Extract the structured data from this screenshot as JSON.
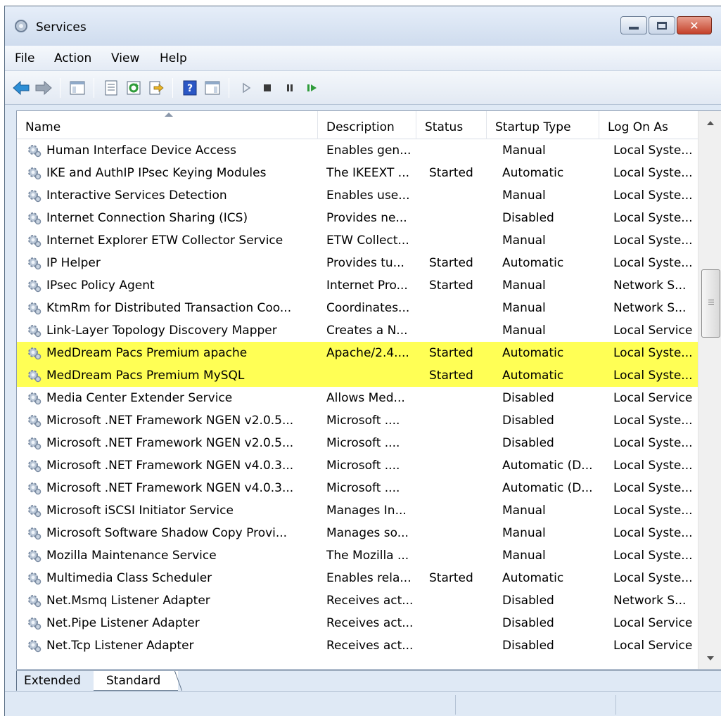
{
  "window": {
    "title": "Services"
  },
  "menu": [
    "File",
    "Action",
    "View",
    "Help"
  ],
  "columns": [
    "Name",
    "Description",
    "Status",
    "Startup Type",
    "Log On As"
  ],
  "rows": [
    {
      "name": "Human Interface Device Access",
      "description": "Enables gen...",
      "status": "",
      "startup": "Manual",
      "logon": "Local Syste...",
      "highlighted": false
    },
    {
      "name": "IKE and AuthIP IPsec Keying Modules",
      "description": "The IKEEXT ...",
      "status": "Started",
      "startup": "Automatic",
      "logon": "Local Syste...",
      "highlighted": false
    },
    {
      "name": "Interactive Services Detection",
      "description": "Enables use...",
      "status": "",
      "startup": "Manual",
      "logon": "Local Syste...",
      "highlighted": false
    },
    {
      "name": "Internet Connection Sharing (ICS)",
      "description": "Provides ne...",
      "status": "",
      "startup": "Disabled",
      "logon": "Local Syste...",
      "highlighted": false
    },
    {
      "name": "Internet Explorer ETW Collector Service",
      "description": "ETW Collect...",
      "status": "",
      "startup": "Manual",
      "logon": "Local Syste...",
      "highlighted": false
    },
    {
      "name": "IP Helper",
      "description": "Provides tu...",
      "status": "Started",
      "startup": "Automatic",
      "logon": "Local Syste...",
      "highlighted": false
    },
    {
      "name": "IPsec Policy Agent",
      "description": "Internet Pro...",
      "status": "Started",
      "startup": "Manual",
      "logon": "Network S...",
      "highlighted": false
    },
    {
      "name": "KtmRm for Distributed Transaction Coo...",
      "description": "Coordinates...",
      "status": "",
      "startup": "Manual",
      "logon": "Network S...",
      "highlighted": false
    },
    {
      "name": "Link-Layer Topology Discovery Mapper",
      "description": "Creates a N...",
      "status": "",
      "startup": "Manual",
      "logon": "Local Service",
      "highlighted": false
    },
    {
      "name": "MedDream Pacs Premium apache",
      "description": "Apache/2.4....",
      "status": "Started",
      "startup": "Automatic",
      "logon": "Local Syste...",
      "highlighted": true
    },
    {
      "name": "MedDream Pacs Premium MySQL",
      "description": "",
      "status": "Started",
      "startup": "Automatic",
      "logon": "Local Syste...",
      "highlighted": true
    },
    {
      "name": "Media Center Extender Service",
      "description": "Allows Med...",
      "status": "",
      "startup": "Disabled",
      "logon": "Local Service",
      "highlighted": false
    },
    {
      "name": "Microsoft .NET Framework NGEN v2.0.5...",
      "description": "Microsoft ....",
      "status": "",
      "startup": "Disabled",
      "logon": "Local Syste...",
      "highlighted": false
    },
    {
      "name": "Microsoft .NET Framework NGEN v2.0.5...",
      "description": "Microsoft ....",
      "status": "",
      "startup": "Disabled",
      "logon": "Local Syste...",
      "highlighted": false
    },
    {
      "name": "Microsoft .NET Framework NGEN v4.0.3...",
      "description": "Microsoft ....",
      "status": "",
      "startup": "Automatic (D...",
      "logon": "Local Syste...",
      "highlighted": false
    },
    {
      "name": "Microsoft .NET Framework NGEN v4.0.3...",
      "description": "Microsoft ....",
      "status": "",
      "startup": "Automatic (D...",
      "logon": "Local Syste...",
      "highlighted": false
    },
    {
      "name": "Microsoft iSCSI Initiator Service",
      "description": "Manages In...",
      "status": "",
      "startup": "Manual",
      "logon": "Local Syste...",
      "highlighted": false
    },
    {
      "name": "Microsoft Software Shadow Copy Provi...",
      "description": "Manages so...",
      "status": "",
      "startup": "Manual",
      "logon": "Local Syste...",
      "highlighted": false
    },
    {
      "name": "Mozilla Maintenance Service",
      "description": "The Mozilla ...",
      "status": "",
      "startup": "Manual",
      "logon": "Local Syste...",
      "highlighted": false
    },
    {
      "name": "Multimedia Class Scheduler",
      "description": "Enables rela...",
      "status": "Started",
      "startup": "Automatic",
      "logon": "Local Syste...",
      "highlighted": false
    },
    {
      "name": "Net.Msmq Listener Adapter",
      "description": "Receives act...",
      "status": "",
      "startup": "Disabled",
      "logon": "Network S...",
      "highlighted": false
    },
    {
      "name": "Net.Pipe Listener Adapter",
      "description": "Receives act...",
      "status": "",
      "startup": "Disabled",
      "logon": "Local Service",
      "highlighted": false
    },
    {
      "name": "Net.Tcp Listener Adapter",
      "description": "Receives act...",
      "status": "",
      "startup": "Disabled",
      "logon": "Local Service",
      "highlighted": false
    }
  ],
  "tabs": [
    "Extended",
    "Standard"
  ],
  "colors": {
    "highlight": "#ffff55",
    "title_bg": "#dfe9f5"
  }
}
